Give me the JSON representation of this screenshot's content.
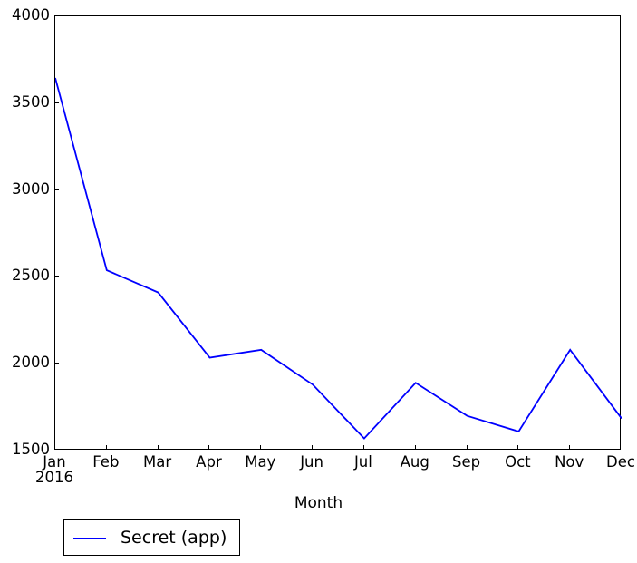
{
  "chart_data": {
    "type": "line",
    "title": "",
    "xlabel": "Month",
    "ylabel": "",
    "categories": [
      "Jan",
      "Feb",
      "Mar",
      "Apr",
      "May",
      "Jun",
      "Jul",
      "Aug",
      "Sep",
      "Oct",
      "Nov",
      "Dec"
    ],
    "x_period_label": "2016",
    "series": [
      {
        "name": "Secret (app)",
        "color": "#0000ff",
        "values": [
          3645,
          2538,
          2410,
          2035,
          2080,
          1880,
          1570,
          1890,
          1700,
          1610,
          2080,
          1685
        ]
      }
    ],
    "ylim": [
      1500,
      4000
    ],
    "ytick_labels": [
      "1500",
      "2000",
      "2500",
      "3000",
      "3500",
      "4000"
    ],
    "ytick_values": [
      1500,
      2000,
      2500,
      3000,
      3500,
      4000
    ],
    "grid": false,
    "legend_position": "below-axes-left"
  },
  "axis": {
    "x_title": "Month"
  },
  "legend": {
    "entries": [
      {
        "label": "Secret (app)",
        "color": "#0000ff"
      }
    ]
  }
}
